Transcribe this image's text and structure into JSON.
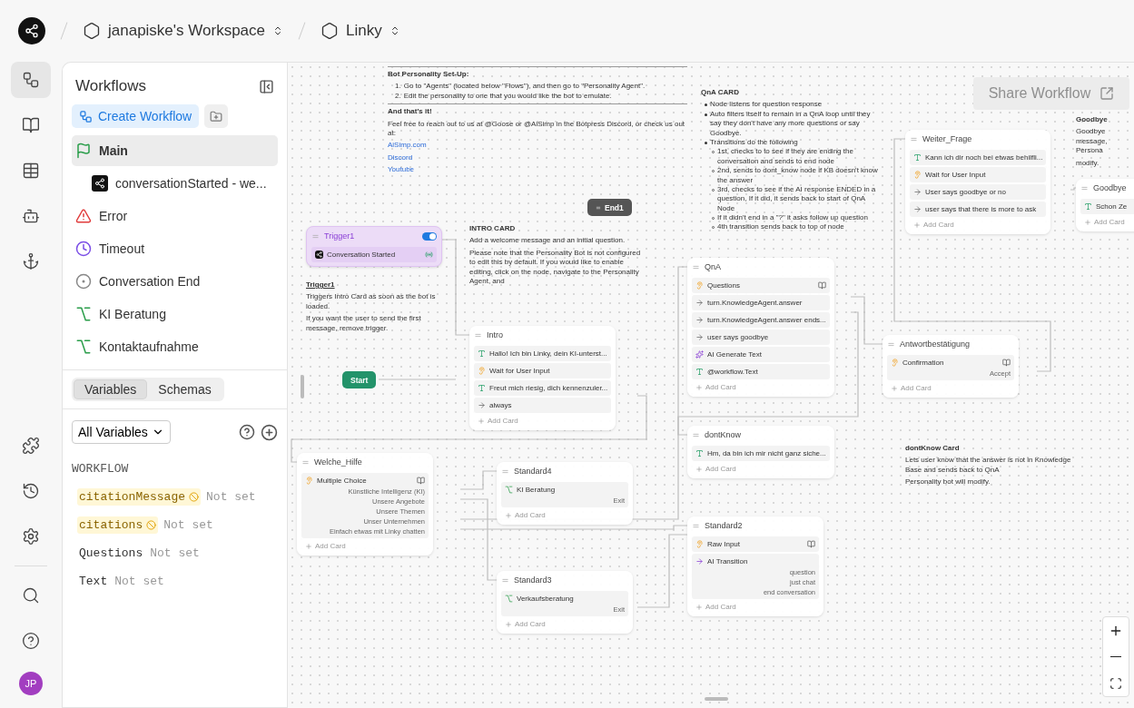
{
  "breadcrumb": [
    {
      "label": "janapiske's Workspace"
    },
    {
      "label": "Linky"
    }
  ],
  "rail": {
    "top": [
      {
        "kind": "workflows",
        "selected": true
      },
      {
        "kind": "knowledge",
        "selected": false
      },
      {
        "kind": "tables",
        "selected": false
      },
      {
        "kind": "agents",
        "selected": false
      },
      {
        "kind": "hooks",
        "selected": false
      }
    ],
    "middle": [
      {
        "kind": "integrations",
        "selected": false
      },
      {
        "kind": "history",
        "selected": false
      },
      {
        "kind": "settings",
        "selected": false
      }
    ],
    "bottom": [
      {
        "kind": "search",
        "selected": false
      },
      {
        "kind": "help",
        "selected": false
      }
    ]
  },
  "avatar": {
    "initials": "JP"
  },
  "sidebar": {
    "title": "Workflows",
    "create_button": "Create Workflow",
    "workflows": [
      {
        "label": "Main",
        "kind": "main",
        "selected": true,
        "children": [
          {
            "label": "conversationStarted - we...",
            "kind": "trigger",
            "selected": false
          }
        ]
      },
      {
        "label": "Error",
        "kind": "error",
        "selected": false
      },
      {
        "label": "Timeout",
        "kind": "timeout",
        "selected": false
      },
      {
        "label": "Conversation End",
        "kind": "end",
        "selected": false
      },
      {
        "label": "KI Beratung",
        "kind": "subflow",
        "selected": false
      },
      {
        "label": "Kontaktaufnahme",
        "kind": "subflow",
        "selected": false
      }
    ],
    "tabs": [
      {
        "label": "Variables",
        "selected": true
      },
      {
        "label": "Schemas",
        "selected": false
      }
    ],
    "filter": {
      "value": "All Variables"
    },
    "variable_section": "WORKFLOW",
    "variables": [
      {
        "name": "citationMessage",
        "value": "Not set",
        "warning": true
      },
      {
        "name": "citations",
        "value": "Not set",
        "warning": true
      },
      {
        "name": "Questions",
        "value": "Not set",
        "warning": false
      },
      {
        "name": "Text",
        "value": "Not set",
        "warning": false
      }
    ]
  },
  "canvas": {
    "share_button": {
      "label": "Share Workflow",
      "disabled": true
    },
    "notes": [
      {
        "blocks": [
          {
            "kind": "rule"
          },
          {
            "kind": "heading",
            "text": "Bot Personality Set-Up:"
          },
          {
            "kind": "ordered",
            "items": [
              {
                "number": "1.",
                "text": "Go to \"Agents\" (located below \"Flows\"), and then go to \"Personality Agent\"."
              },
              {
                "number": "2.",
                "text": "Edit the personality to one that you would like the bot to emulate."
              }
            ]
          },
          {
            "kind": "rule"
          },
          {
            "kind": "heading",
            "text": "And that's it!"
          },
          {
            "kind": "text",
            "text": "Feel free to reach out to us at @Goose or @AiSimp in the Botpress Discord, or check us out at:"
          },
          {
            "kind": "link",
            "text": "AiSimp.com"
          },
          {
            "kind": "link",
            "text": "Discord"
          },
          {
            "kind": "link",
            "text": "Youtube"
          }
        ]
      },
      {
        "blocks": [
          {
            "kind": "heading",
            "text": "QnA CARD"
          },
          {
            "kind": "bullets",
            "items": [
              {
                "text": "Node listens for question response"
              },
              {
                "text": "Auto filters itself to remain in a QnA loop until they say they don't have any more questions or say Goodbye."
              },
              {
                "text": "Transitions do the following",
                "children": [
                  {
                    "text": "1st, checks to to see if they are ending the conversation and sends to end node"
                  },
                  {
                    "text": "2nd, sends to dont_know node if KB doesn't know the answer"
                  },
                  {
                    "text": "3rd, checks to see if the AI response ENDED in a question, If it did, it sends back to start of QnA Node"
                  },
                  {
                    "text": "If it didn't end in a \"?\" it asks follow up question"
                  },
                  {
                    "text": "4th transition sends back to top of node"
                  }
                ]
              }
            ]
          }
        ]
      },
      {
        "blocks": [
          {
            "kind": "heading",
            "text": "Goodbye"
          },
          {
            "kind": "text",
            "text": "Goodbye message, Persona"
          },
          {
            "kind": "text",
            "text": "modify."
          }
        ]
      },
      {
        "blocks": [
          {
            "kind": "heading",
            "text": "INTRO CARD"
          },
          {
            "kind": "text",
            "text": "Add a welcome message and an initial question."
          },
          {
            "kind": "text",
            "text": "Please note that the Personality Bot is not configured to edit this by default. If you would like to enable editing, click on the node, navigate to the Personality Agent, and"
          }
        ]
      },
      {
        "blocks": [
          {
            "kind": "underlined",
            "text": "Trigger1"
          },
          {
            "kind": "text",
            "text": "Triggers Intro Card as soon as the bot is loaded."
          },
          {
            "kind": "text",
            "text": "If you want the user to send the first message, remove trigger."
          }
        ]
      },
      {
        "blocks": [
          {
            "kind": "heading",
            "text": "dontKnow Card"
          },
          {
            "kind": "text",
            "text": "Lets user know that the answer is not in Knowledge Base and sends back to QnA"
          },
          {
            "kind": "text",
            "text": "Personality bot will modify."
          }
        ]
      }
    ],
    "nodes": [
      {
        "kind": "trigger",
        "title": "Trigger1",
        "on": true,
        "cards": [
          {
            "kind": "event",
            "label": "Conversation Started"
          }
        ]
      },
      {
        "kind": "start",
        "title": "Start"
      },
      {
        "kind": "end",
        "title": "End1"
      },
      {
        "kind": "standard",
        "title": "Intro",
        "add_card": "Add Card",
        "cards": [
          {
            "kind": "text",
            "label": "Hallo! Ich bin Linky, dein KI-unterst..."
          },
          {
            "kind": "wait",
            "label": "Wait for User Input"
          },
          {
            "kind": "text",
            "label": "Freut mich riesig, dich kennenzuler..."
          },
          {
            "kind": "transition",
            "label": "always"
          }
        ]
      },
      {
        "kind": "standard",
        "title": "QnA",
        "add_card": "Add Card",
        "cards": [
          {
            "kind": "capture",
            "label": "Questions"
          },
          {
            "kind": "transition",
            "label": "turn.KnowledgeAgent.answer"
          },
          {
            "kind": "transition",
            "label": "turn.KnowledgeAgent.answer ends..."
          },
          {
            "kind": "transition",
            "label": "user says goodbye"
          },
          {
            "kind": "ai-text",
            "label": "AI Generate Text"
          },
          {
            "kind": "text",
            "label": "@workflow.Text"
          }
        ]
      },
      {
        "kind": "standard",
        "title": "Weiter_Frage",
        "add_card": "Add Card",
        "cards": [
          {
            "kind": "text",
            "label": "Kann ich dir noch bei etwas behilfli..."
          },
          {
            "kind": "wait",
            "label": "Wait for User Input"
          },
          {
            "kind": "transition",
            "label": "User says goodbye or no"
          },
          {
            "kind": "transition",
            "label": "user says that there is more to ask"
          }
        ]
      },
      {
        "kind": "standard",
        "title": "Goodbye",
        "add_card": "Add Card",
        "cards": [
          {
            "kind": "text",
            "label": "Schon Ze"
          }
        ]
      },
      {
        "kind": "standard",
        "title": "Antwortbestätigung",
        "add_card": "Add Card",
        "cards": [
          {
            "kind": "capture",
            "label": "Confirmation",
            "outputs": [
              "Accept"
            ]
          }
        ]
      },
      {
        "kind": "standard",
        "title": "Welche_Hilfe",
        "add_card": "Add Card",
        "cards": [
          {
            "kind": "capture",
            "label": "Multiple Choice",
            "outputs": [
              "Künstliche Intelligenz (KI)",
              "Unsere Angebote",
              "Unsere Themen",
              "Unser Unternehmen",
              "Einfach etwas mit Linky chatten"
            ]
          }
        ]
      },
      {
        "kind": "standard",
        "title": "Standard4",
        "add_card": "Add Card",
        "cards": [
          {
            "kind": "subflow",
            "label": "KI Beratung",
            "outputs": [
              "Exit"
            ]
          }
        ]
      },
      {
        "kind": "standard",
        "title": "dontKnow",
        "add_card": "Add Card",
        "cards": [
          {
            "kind": "text",
            "label": "Hm, da bin ich mir nicht ganz siche..."
          }
        ]
      },
      {
        "kind": "standard",
        "title": "Standard2",
        "add_card": "Add Card",
        "cards": [
          {
            "kind": "capture",
            "label": "Raw Input"
          },
          {
            "kind": "ai-transition",
            "label": "AI Transition",
            "outputs": [
              "question",
              "just chat",
              "end conversation"
            ]
          }
        ]
      },
      {
        "kind": "standard",
        "title": "Standard3",
        "add_card": "Add Card",
        "cards": [
          {
            "kind": "subflow",
            "label": "Verkaufsberatung",
            "outputs": [
              "Exit"
            ]
          }
        ]
      }
    ]
  }
}
